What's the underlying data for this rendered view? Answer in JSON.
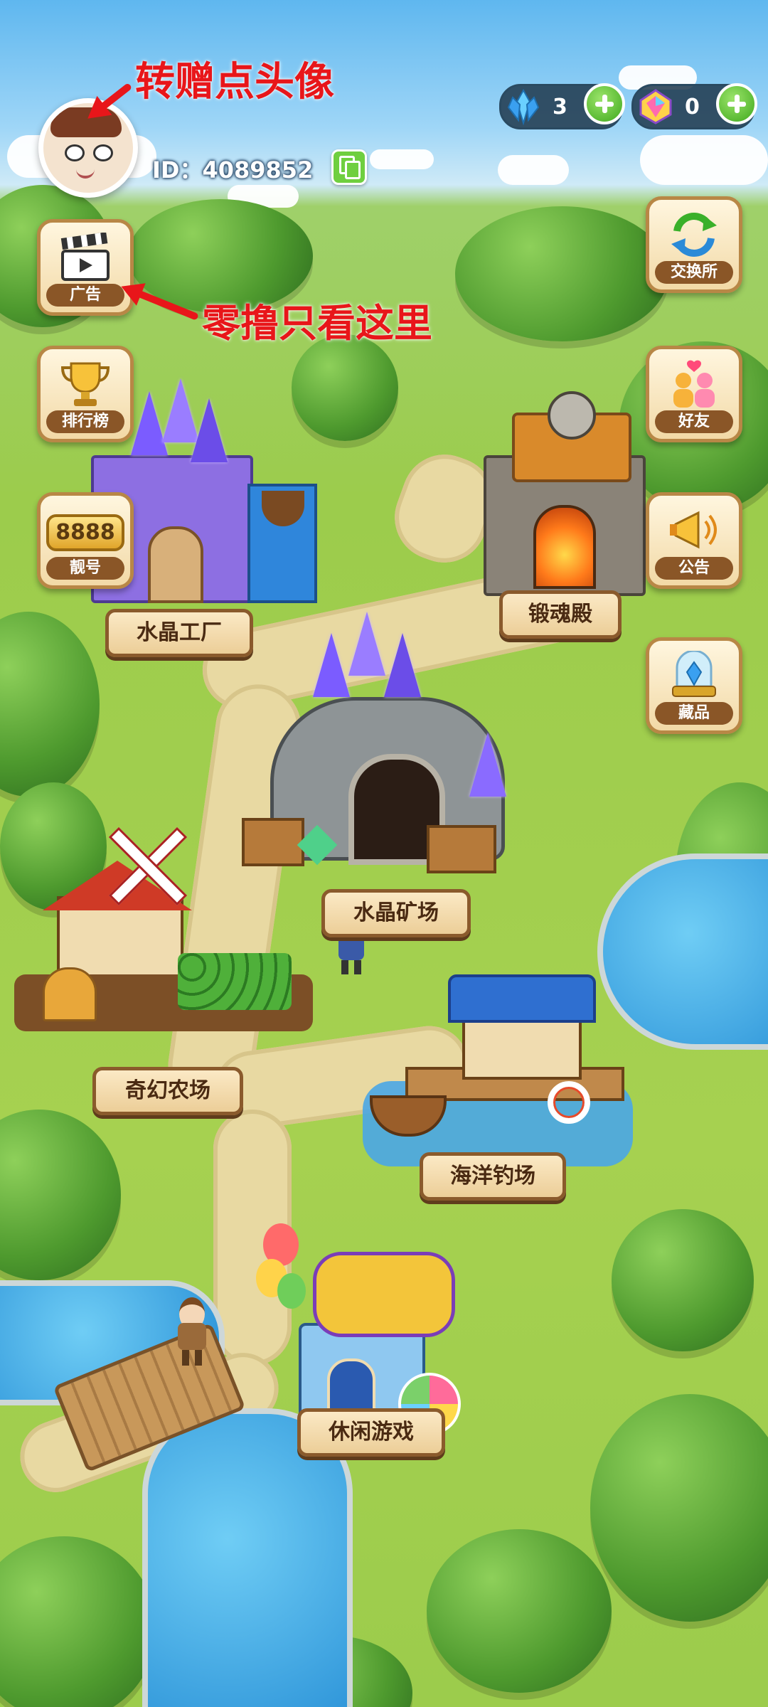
{
  "profile": {
    "id_label": "ID：4089852"
  },
  "currency": [
    {
      "icon": "blue-crystal-icon",
      "value": "3"
    },
    {
      "icon": "rainbow-gem-icon",
      "value": "0"
    }
  ],
  "annotations": {
    "avatar_hint": "转赠点头像",
    "ad_hint": "零撸只看这里"
  },
  "left_menu": [
    {
      "label": "广告",
      "icon": "clapperboard-icon"
    },
    {
      "label": "排行榜",
      "icon": "trophy-icon"
    },
    {
      "label": "靓号",
      "icon": "number-badge-icon",
      "badge_text": "8888"
    }
  ],
  "right_menu": [
    {
      "label": "交换所",
      "icon": "exchange-arrows-icon"
    },
    {
      "label": "好友",
      "icon": "friends-icon"
    },
    {
      "label": "公告",
      "icon": "megaphone-icon"
    },
    {
      "label": "藏品",
      "icon": "collection-crystal-icon"
    }
  ],
  "locations": [
    {
      "label": "水晶工厂"
    },
    {
      "label": "锻魂殿"
    },
    {
      "label": "水晶矿场"
    },
    {
      "label": "奇幻农场"
    },
    {
      "label": "海洋钓场"
    },
    {
      "label": "休闲游戏"
    }
  ],
  "colors": {
    "annotation_red": "#e8161a",
    "plaque_border": "#8a5a2c",
    "sky": "#5fb7ef",
    "grass": "#9ccc4c"
  }
}
